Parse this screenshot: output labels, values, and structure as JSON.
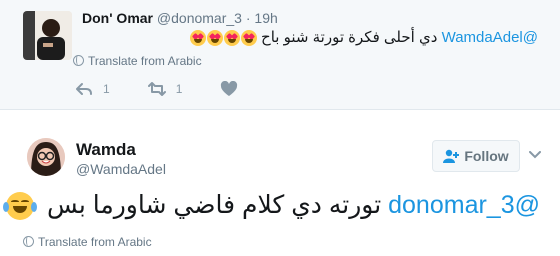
{
  "tweet1": {
    "name": "Don' Omar",
    "handle": "@donomar_3",
    "separator": "·",
    "time": "19h",
    "mention": "@WamdaAdel",
    "text": "دي أحلى فكرة تورتة شنو باح",
    "emoji": "heart-eyes-face x4",
    "translate": "Translate from Arabic",
    "replies": "1",
    "retweets": "1"
  },
  "tweet2": {
    "name": "Wamda",
    "handle": "@WamdaAdel",
    "follow_label": "Follow",
    "mention": "@donomar_3",
    "text": "تورته دي كلام فاضي شاورما بس",
    "emoji": "tears-of-joy-face",
    "translate": "Translate from Arabic"
  },
  "colors": {
    "link": "#1b95e0",
    "muted": "#657786",
    "top_bg": "#f5f8fa"
  }
}
